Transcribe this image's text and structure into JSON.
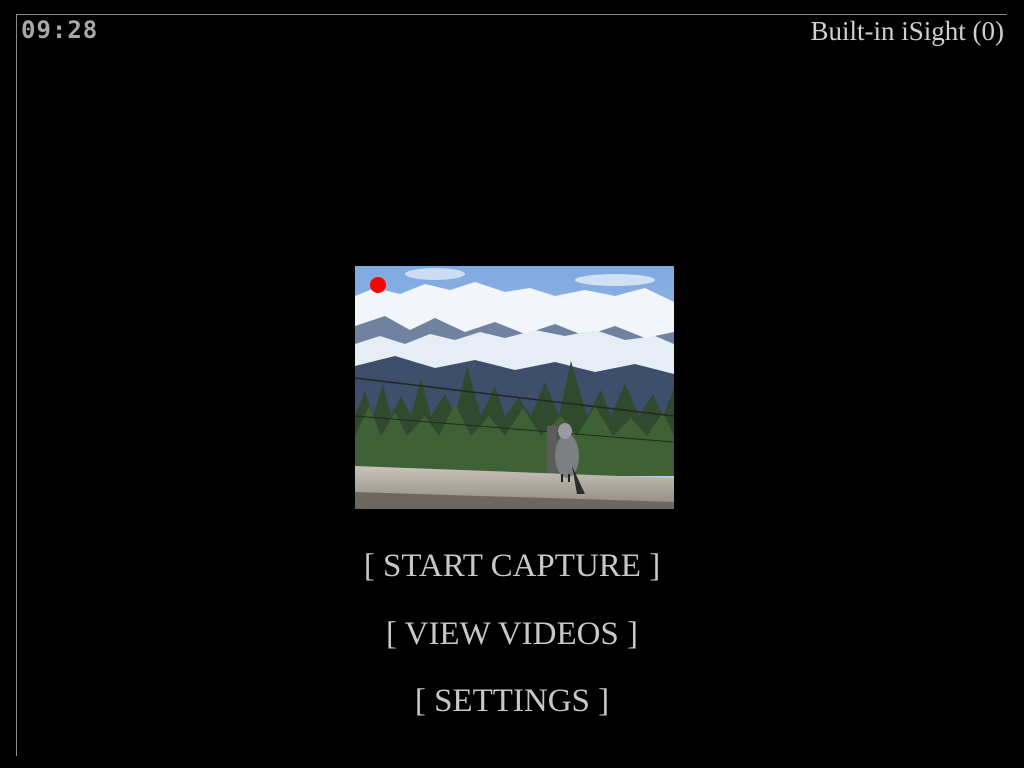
{
  "status_bar": {
    "clock": "09:28",
    "camera_name": "Built-in iSight (0)"
  },
  "preview": {
    "recording_indicator_color": "#ff0000"
  },
  "menu": {
    "items": [
      {
        "label": "[ START CAPTURE ]"
      },
      {
        "label": "[ VIEW VIDEOS ]"
      },
      {
        "label": "[ SETTINGS ]"
      }
    ]
  },
  "colors": {
    "background": "#000000",
    "text": "#c8c8c8",
    "recording": "#ff0000"
  }
}
